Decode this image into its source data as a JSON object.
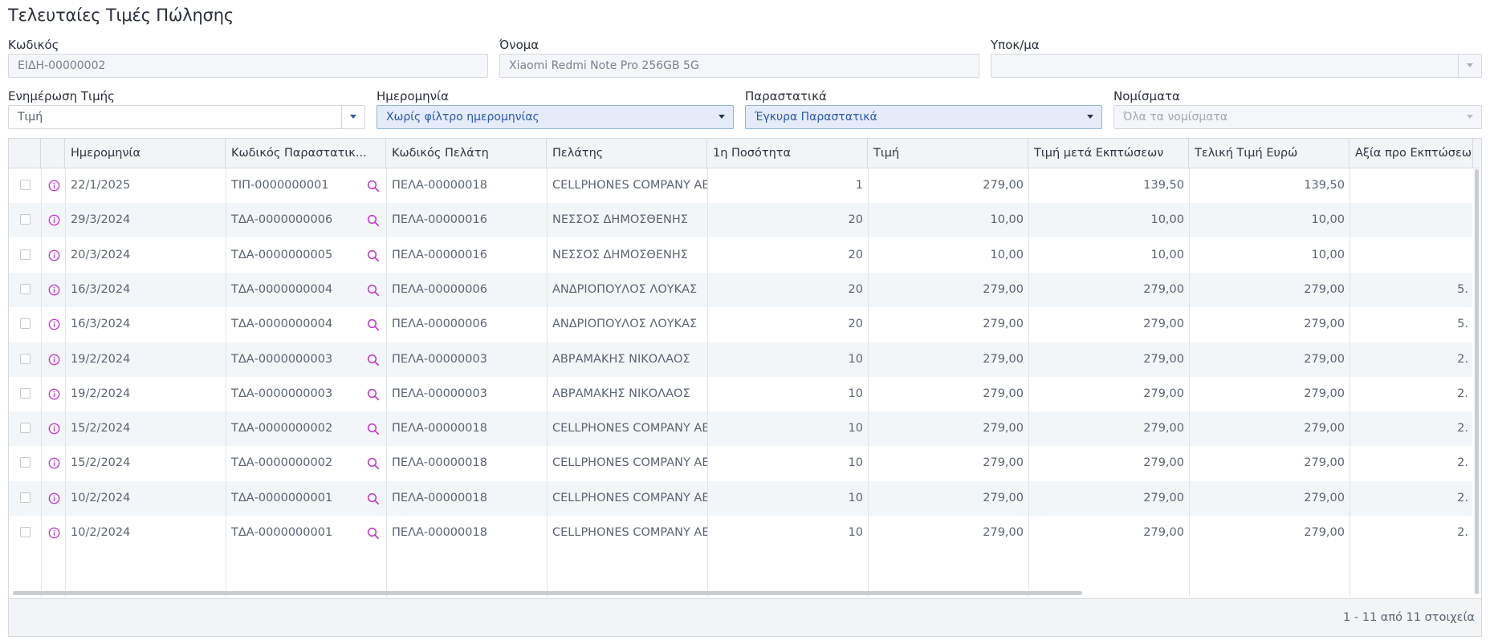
{
  "page": {
    "title": "Τελευταίες Τιμές Πώλησης"
  },
  "filters": {
    "code": {
      "label": "Κωδικός",
      "value": "ΕΙΔΗ-00000002"
    },
    "name": {
      "label": "Όνομα",
      "value": "Xiaomi Redmi Note Pro 256GB 5G"
    },
    "branch": {
      "label": "Υποκ/μα",
      "value": ""
    },
    "price_update": {
      "label": "Ενημέρωση Τιμής",
      "value": "Τιμή"
    },
    "date": {
      "label": "Ημερομηνία",
      "value": "Χωρίς φίλτρο ημερομηνίας"
    },
    "documents": {
      "label": "Παραστατικά",
      "value": "Έγκυρα Παραστατικά"
    },
    "currencies": {
      "label": "Νομίσματα",
      "value": "Όλα τα νομίσματα"
    }
  },
  "grid": {
    "columns": [
      "Ημερομηνία",
      "Κωδικός Παραστατικ...",
      "Κωδικός Πελάτη",
      "Πελάτης",
      "1η Ποσότητα",
      "Τιμή",
      "Τιμή μετά Εκπτώσεων",
      "Τελική Τιμή Ευρώ",
      "Αξία προ Εκπτώσεων."
    ],
    "rows": [
      {
        "date": "22/1/2025",
        "doc_code": "ΤΙΠ-0000000001",
        "customer_code": "ΠΕΛΑ-00000018",
        "customer": "CELLPHONES COMPANY AE",
        "qty": "1",
        "price": "279,00",
        "price_after_discount": "139,50",
        "final_price_eur": "139,50",
        "value_before_discount": ""
      },
      {
        "date": "29/3/2024",
        "doc_code": "ΤΔΑ-0000000006",
        "customer_code": "ΠΕΛΑ-00000016",
        "customer": "ΝΕΣΣΟΣ ΔΗΜΟΣΘΕΝΗΣ",
        "qty": "20",
        "price": "10,00",
        "price_after_discount": "10,00",
        "final_price_eur": "10,00",
        "value_before_discount": ""
      },
      {
        "date": "20/3/2024",
        "doc_code": "ΤΔΑ-0000000005",
        "customer_code": "ΠΕΛΑ-00000016",
        "customer": "ΝΕΣΣΟΣ ΔΗΜΟΣΘΕΝΗΣ",
        "qty": "20",
        "price": "10,00",
        "price_after_discount": "10,00",
        "final_price_eur": "10,00",
        "value_before_discount": ""
      },
      {
        "date": "16/3/2024",
        "doc_code": "ΤΔΑ-0000000004",
        "customer_code": "ΠΕΛΑ-00000006",
        "customer": "ΑΝΔΡΙΟΠΟΥΛΟΣ ΛΟΥΚΑΣ",
        "qty": "20",
        "price": "279,00",
        "price_after_discount": "279,00",
        "final_price_eur": "279,00",
        "value_before_discount": "5."
      },
      {
        "date": "16/3/2024",
        "doc_code": "ΤΔΑ-0000000004",
        "customer_code": "ΠΕΛΑ-00000006",
        "customer": "ΑΝΔΡΙΟΠΟΥΛΟΣ ΛΟΥΚΑΣ",
        "qty": "20",
        "price": "279,00",
        "price_after_discount": "279,00",
        "final_price_eur": "279,00",
        "value_before_discount": "5."
      },
      {
        "date": "19/2/2024",
        "doc_code": "ΤΔΑ-0000000003",
        "customer_code": "ΠΕΛΑ-00000003",
        "customer": "ΑΒΡΑΜΑΚΗΣ ΝΙΚΟΛΑΟΣ",
        "qty": "10",
        "price": "279,00",
        "price_after_discount": "279,00",
        "final_price_eur": "279,00",
        "value_before_discount": "2."
      },
      {
        "date": "19/2/2024",
        "doc_code": "ΤΔΑ-0000000003",
        "customer_code": "ΠΕΛΑ-00000003",
        "customer": "ΑΒΡΑΜΑΚΗΣ ΝΙΚΟΛΑΟΣ",
        "qty": "10",
        "price": "279,00",
        "price_after_discount": "279,00",
        "final_price_eur": "279,00",
        "value_before_discount": "2."
      },
      {
        "date": "15/2/2024",
        "doc_code": "ΤΔΑ-0000000002",
        "customer_code": "ΠΕΛΑ-00000018",
        "customer": "CELLPHONES COMPANY AE",
        "qty": "10",
        "price": "279,00",
        "price_after_discount": "279,00",
        "final_price_eur": "279,00",
        "value_before_discount": "2."
      },
      {
        "date": "15/2/2024",
        "doc_code": "ΤΔΑ-0000000002",
        "customer_code": "ΠΕΛΑ-00000018",
        "customer": "CELLPHONES COMPANY AE",
        "qty": "10",
        "price": "279,00",
        "price_after_discount": "279,00",
        "final_price_eur": "279,00",
        "value_before_discount": "2."
      },
      {
        "date": "10/2/2024",
        "doc_code": "ΤΔΑ-0000000001",
        "customer_code": "ΠΕΛΑ-00000018",
        "customer": "CELLPHONES COMPANY AE",
        "qty": "10",
        "price": "279,00",
        "price_after_discount": "279,00",
        "final_price_eur": "279,00",
        "value_before_discount": "2."
      },
      {
        "date": "10/2/2024",
        "doc_code": "ΤΔΑ-0000000001",
        "customer_code": "ΠΕΛΑ-00000018",
        "customer": "CELLPHONES COMPANY AE",
        "qty": "10",
        "price": "279,00",
        "price_after_discount": "279,00",
        "final_price_eur": "279,00",
        "value_before_discount": "2."
      }
    ],
    "pager_text": "1 - 11 από 11 στοιχεία"
  },
  "icons": {
    "row_info": "info-circle-icon",
    "doc_search": "search-icon",
    "dropdown": "caret-down-icon"
  },
  "colors": {
    "accent_blue": "#2f56a8",
    "dropdown_blue_bg": "#e3ecf8",
    "icon_magenta": "#c23fc9",
    "alt_row": "#f3f6f9"
  }
}
